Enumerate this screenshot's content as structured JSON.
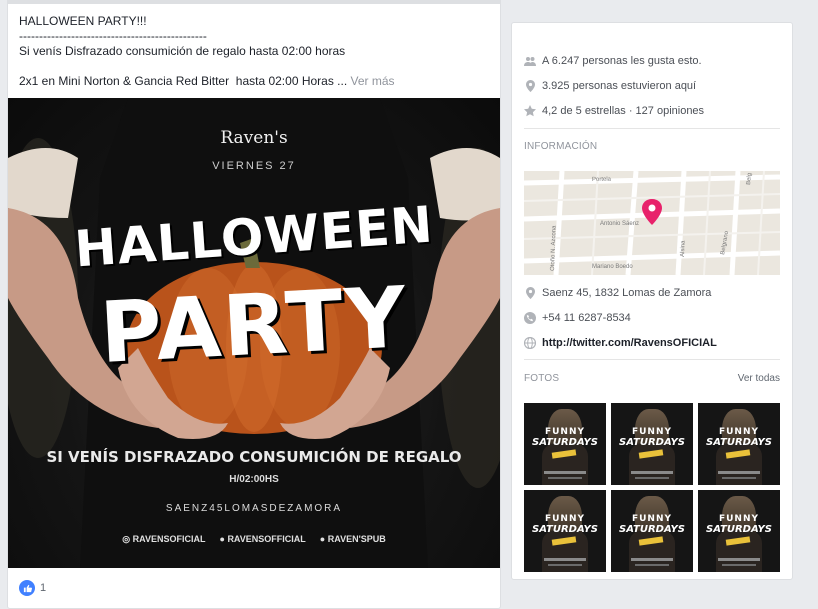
{
  "post": {
    "line1": "HALLOWEEN PARTY!!!",
    "line2": "-----------------------------------------------",
    "line3": "Si venís Disfrazado consumición de regalo hasta 02:00 horas",
    "line4": "2x1 en Mini Norton & Gancia Red Bitter  hasta 02:00 Horas ... ",
    "see_more": "Ver más",
    "likes": "1"
  },
  "poster": {
    "brand": "Raven's",
    "day": "VIERNES 27",
    "title1": "HALLOWEEN",
    "title2": "PARTY",
    "promo": "SI VENÍS DISFRAZADO CONSUMICIÓN DE REGALO",
    "time": "H/02:00HS",
    "address": "SAENZ45LOMASDEZAMORA",
    "social1": "RAVENSOFICIAL",
    "social2": "RAVENSOFFICIAL",
    "social3": "RAVEN'SPUB"
  },
  "side": {
    "likes": "A 6.247 personas les gusta esto.",
    "checkins": "3.925 personas estuvieron aquí",
    "rating": "4,2 de 5 estrellas · 127 opiniones",
    "info_title": "INFORMACIÓN",
    "address": "Saenz 45, 1832 Lomas de Zamora",
    "phone": "+54 11 6287-8534",
    "website": "http://twitter.com/RavensOFICIAL",
    "photos_title": "FOTOS",
    "see_all": "Ver todas"
  },
  "map": {
    "streets": [
      "Portela",
      "Antonio Sáenz",
      "Mariano Boedo",
      "Alsina",
      "Belgrano",
      "Boedo",
      "Laprida",
      "Otoño N. Azcona",
      "Sáenz",
      "Belg"
    ]
  },
  "photos": {
    "line1": "FUNNY",
    "line2": "SATURDAYS"
  },
  "colors": {
    "page_bg": "#e9ebee",
    "like_blue": "#4080ff",
    "map_pin": "#e8226b",
    "pumpkin": "#c4561c"
  }
}
